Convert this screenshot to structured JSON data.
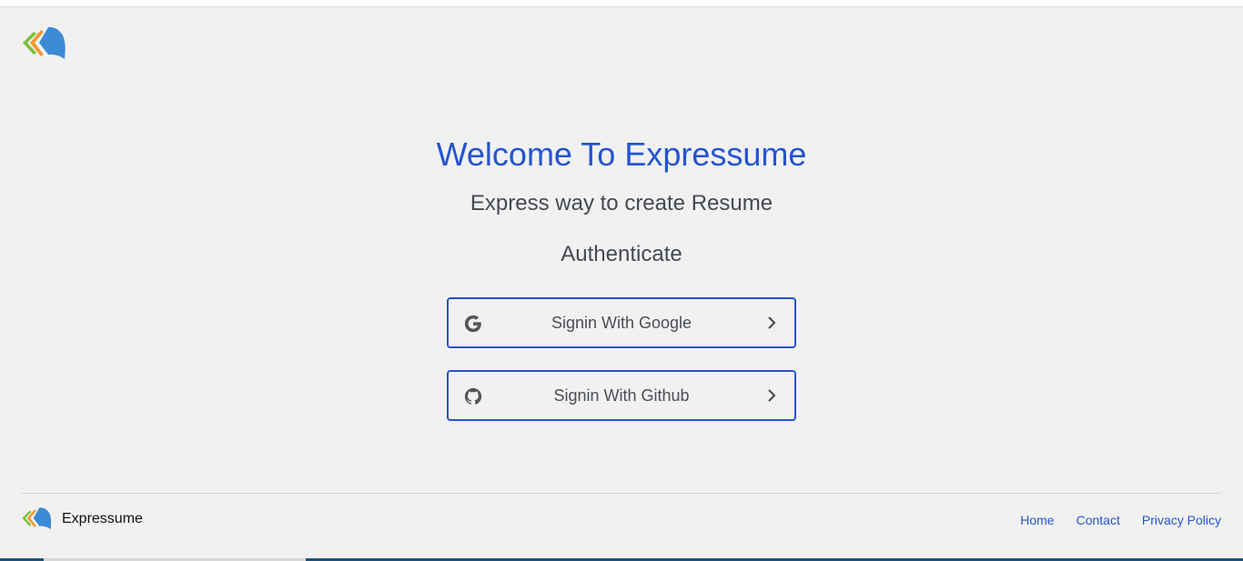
{
  "app": {
    "brand_name": "Expressume"
  },
  "hero": {
    "title": "Welcome To Expressume",
    "subtitle": "Express way to create Resume",
    "auth_label": "Authenticate"
  },
  "auth_buttons": [
    {
      "label": "Signin With Google",
      "icon": "google-icon"
    },
    {
      "label": "Signin With Github",
      "icon": "github-icon"
    }
  ],
  "footer": {
    "brand": "Expressume",
    "links": [
      "Home",
      "Contact",
      "Privacy Policy"
    ]
  },
  "colors": {
    "accent": "#2454cf",
    "background": "#f1f1f1",
    "logo_blue": "#3d8ad6",
    "logo_orange": "#f29a2e",
    "logo_green": "#7cbf3a"
  }
}
